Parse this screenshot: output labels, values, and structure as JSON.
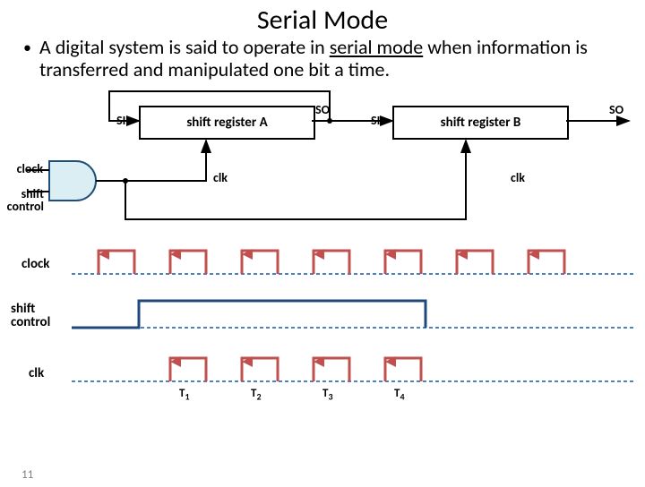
{
  "title": "Serial Mode",
  "description": {
    "prefix": "A digital system is said to operate in ",
    "underlined": "serial mode",
    "suffix": " when information is transferred and manipulated one bit a time."
  },
  "diagram": {
    "si": "SI",
    "so": "SO",
    "regA": "shift register A",
    "regB": "shift register B",
    "clk": "clk",
    "clock": "clock",
    "shift_control": "shift control"
  },
  "timing": {
    "clock": "clock",
    "shift_control": "shift control",
    "clk": "clk",
    "ticks": [
      "T",
      "T",
      "T",
      "T"
    ],
    "tick_subs": [
      "1",
      "2",
      "3",
      "4"
    ]
  },
  "slide_number": "11"
}
